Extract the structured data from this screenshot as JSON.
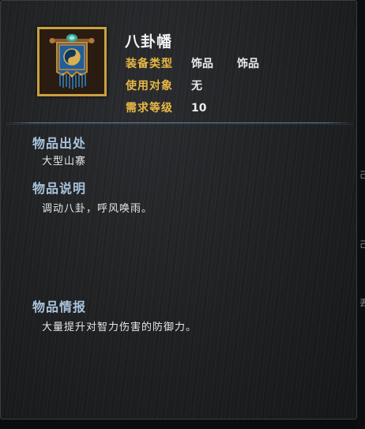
{
  "item": {
    "name": "八卦幡",
    "icon": "banner-icon",
    "attributes": [
      {
        "label": "装备类型",
        "value": "饰品",
        "value2": "饰品"
      },
      {
        "label": "使用对象",
        "value": "无"
      },
      {
        "label": "需求等级",
        "value": "10"
      }
    ]
  },
  "sections": {
    "origin": {
      "title": "物品出处",
      "text": "大型山寨"
    },
    "description": {
      "title": "物品说明",
      "text": "调动八卦，呼风唤雨。"
    },
    "intel": {
      "title": "物品情报",
      "text": "大量提升对智力伤害的防御力。"
    }
  },
  "edge_glyphs": [
    "己",
    "己",
    "丢"
  ],
  "colors": {
    "label": "#e8b844",
    "section_title": "#a9c3dc",
    "frame": "#caa040",
    "banner": "#1e5f9c"
  }
}
